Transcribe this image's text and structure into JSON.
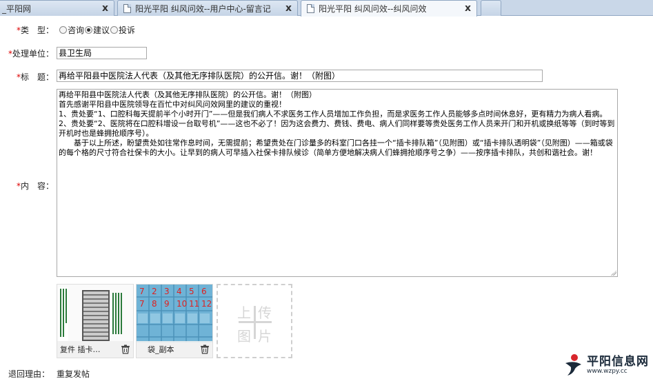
{
  "tabs": [
    {
      "label": "_平阳网",
      "active": false
    },
    {
      "label": "阳光平阳 纠风问效--用户中心-留言记",
      "active": false
    },
    {
      "label": "阳光平阳 纠风问效--纠风问效",
      "active": true
    }
  ],
  "close_glyph": "x",
  "form": {
    "type_label": "类　型：",
    "type_options": [
      "咨询",
      "建议",
      "投诉"
    ],
    "type_selected": "建议",
    "dept_label": "处理单位：",
    "dept_value": "县卫生局",
    "title_label": "标　题：",
    "title_value": "再给平阳县中医院法人代表（及其他无序排队医院）的公开信。谢！（附图）",
    "content_label": "内　容：",
    "content_lines": [
      "再给平阳县中医院法人代表（及其他无序排队医院）的公开信。谢！（附图）",
      "首先感谢平阳县中医院领导在百忙中对纠风问效网里的建议的重视！",
      "1、贵处要“1、口腔科每天提前半个小时开门”——但是我们病人不求医务工作人员增加工作负担，而是求医务工作人员能够多点时间休息好，更有精力为病人看病。",
      "2、贵处要“2、医院将在口腔科增设一台取号机”——这也不必了！因为这会费力、费钱、费电、病人们同样要等贵处医务工作人员来开门和开机或换纸等等（到时等到开机时也是蜂拥抢顺序号）。",
      "　　基于以上所述，盼望贵处如往常作息时间，无需提前；希望贵处在门诊量多的科室门口各挂一个“插卡排队箱”（见附图）或“插卡排队透明袋”（见附图）——箱或袋的每个格的尺寸符合社保卡的大小。让早到的病人可早插入社保卡排队候诊（简单方便地解决病人们蜂拥抢顺序号之争）——按序插卡排队，共创和谐社会。谢！"
    ],
    "reject_label": "退回理由：",
    "reject_value": "重复发帖"
  },
  "attachments": [
    {
      "name": "复件 插卡…"
    },
    {
      "name": "袋_副本"
    }
  ],
  "upload": {
    "chars": [
      "上",
      "传",
      "图",
      "片"
    ]
  },
  "logo": {
    "main": "平阳信息网",
    "sub": "www.wzpy.cc"
  },
  "colors": {
    "required_star": "#dd0000",
    "logo_red": "#d8262c"
  }
}
